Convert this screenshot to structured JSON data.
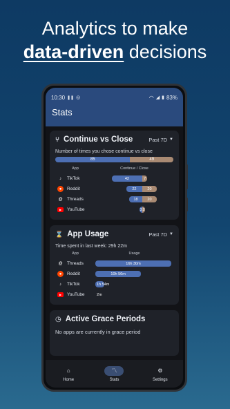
{
  "headline": {
    "line1": "Analytics to make",
    "bold": "data-driven",
    "rest": " decisions"
  },
  "status": {
    "time": "10:30",
    "battery": "83%"
  },
  "appbar": {
    "title": "Stats"
  },
  "continue_close": {
    "title": "Continue vs Close",
    "range": "Past 7D",
    "subtitle": "Number of times you chose continue vs close",
    "total": {
      "continue": 85,
      "close": 49
    },
    "col_app": "App",
    "col_values": "Continue / Close",
    "rows": [
      {
        "app": "TikTok",
        "icon": "tiktok-icon",
        "continue": 42,
        "close": 7,
        "c_label": "42",
        "x_label": "7"
      },
      {
        "app": "Reddit",
        "icon": "reddit-icon",
        "continue": 22,
        "close": 20,
        "c_label": "22",
        "x_label": "20"
      },
      {
        "app": "Threads",
        "icon": "threads-icon",
        "continue": 18,
        "close": 20,
        "c_label": "18",
        "x_label": "20"
      },
      {
        "app": "YouTube",
        "icon": "youtube-icon",
        "continue": 3,
        "close": 2,
        "c_label": "3",
        "x_label": "2"
      }
    ]
  },
  "app_usage": {
    "title": "App Usage",
    "range": "Past 7D",
    "subtitle": "Time spent in last week: 29h 22m",
    "col_app": "App",
    "col_values": "Usage",
    "rows": [
      {
        "app": "Threads",
        "icon": "threads-icon",
        "minutes": 990,
        "label": "16h 30m"
      },
      {
        "app": "Reddit",
        "icon": "reddit-icon",
        "minutes": 596,
        "label": "10h 56m"
      },
      {
        "app": "TikTok",
        "icon": "tiktok-icon",
        "minutes": 114,
        "label": "1h 54m"
      },
      {
        "app": "YouTube",
        "icon": "youtube-icon",
        "minutes": 2,
        "label": "2m"
      }
    ]
  },
  "grace": {
    "title": "Active Grace Periods",
    "text": "No apps are currently in grace period"
  },
  "nav": {
    "home": "Home",
    "stats": "Stats",
    "settings": "Settings"
  },
  "colors": {
    "continue": "#4d6fb3",
    "close": "#a98a73",
    "appbar": "#2a4a7d"
  }
}
